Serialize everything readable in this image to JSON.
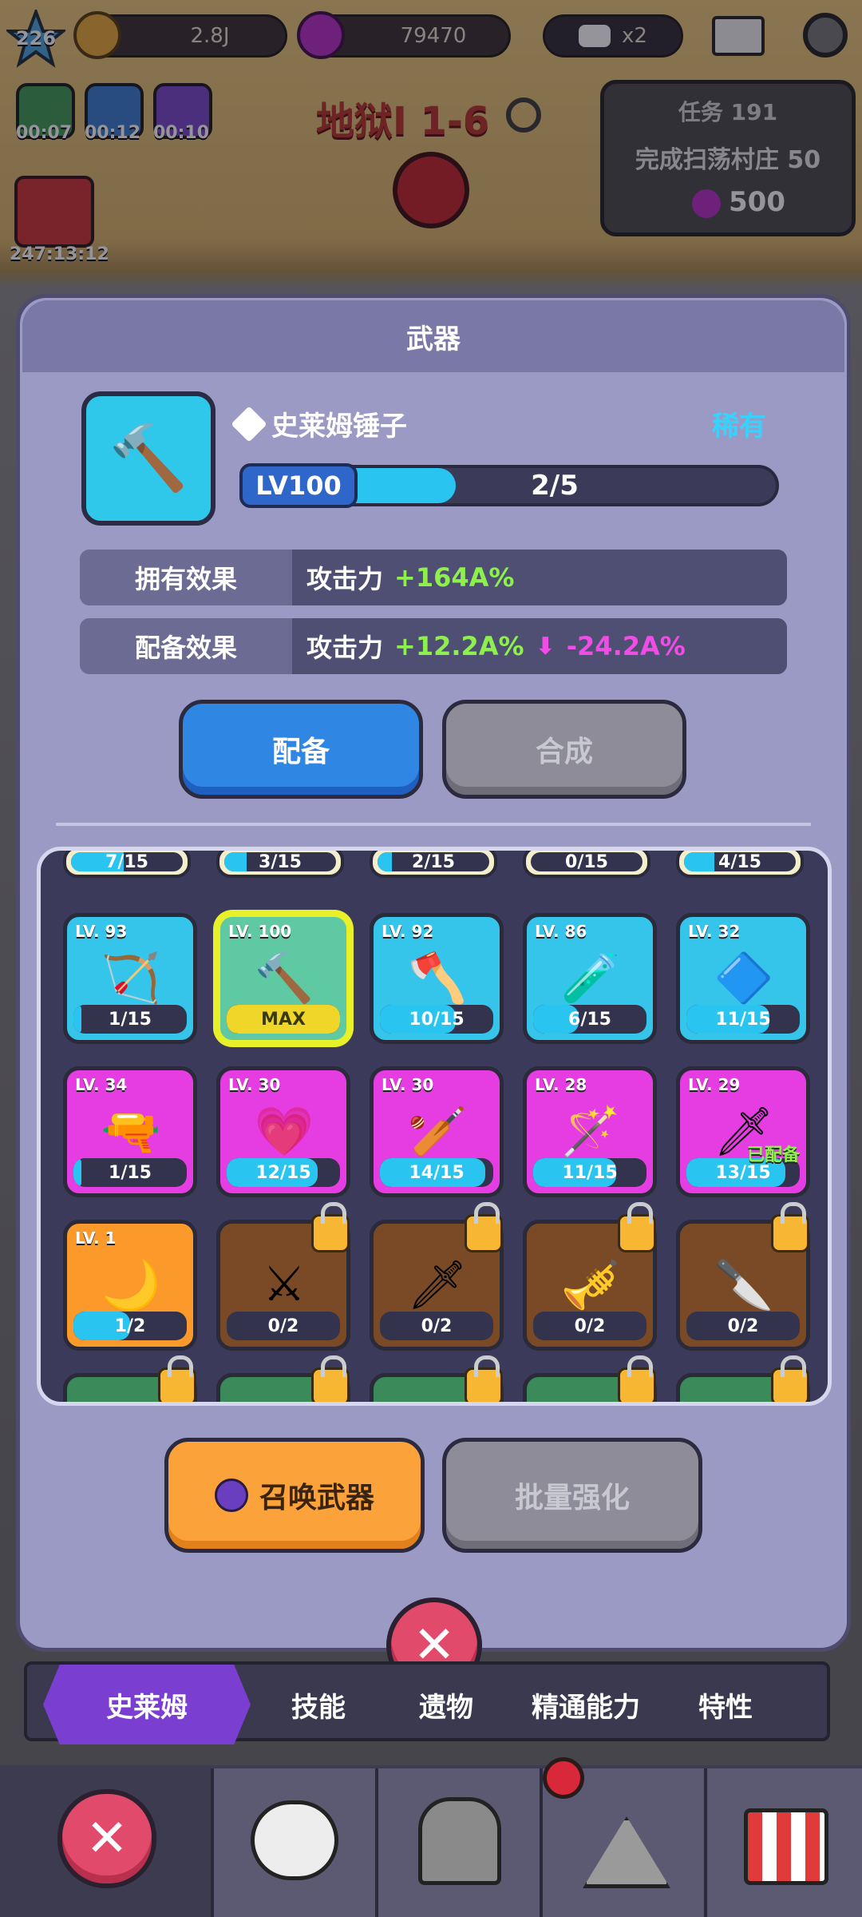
{
  "topbar": {
    "player_level": "226",
    "gold": "2.8J",
    "gems": "79470",
    "video_multiplier": "x2"
  },
  "buffs": [
    {
      "timer": "00:07"
    },
    {
      "timer": "00:12"
    },
    {
      "timer": "00:10"
    }
  ],
  "event_timer": "247:13:12",
  "stage": {
    "name": "地狱I 1-6"
  },
  "quest": {
    "title": "任务 191",
    "desc": "完成扫荡村庄 50",
    "reward": "500"
  },
  "panel": {
    "title": "武器",
    "weapon_name": "史莱姆锤子",
    "rarity": "稀有",
    "level_tag": "LV100",
    "progress_text": "2/5",
    "progress_fraction": 0.4,
    "own_effect_label": "拥有效果",
    "own_effect_stat": "攻击力",
    "own_effect_value": "+164A%",
    "equip_effect_label": "配备效果",
    "equip_effect_stat": "攻击力",
    "equip_effect_value": "+12.2A%",
    "equip_effect_diff": "-24.2A%",
    "equip_button": "配备",
    "merge_button": "合成",
    "summon_button": "召唤武器",
    "bulk_upgrade_button": "批量强化"
  },
  "top_partial_row": [
    {
      "count": "7/15",
      "fill": 0.47
    },
    {
      "count": "3/15",
      "fill": 0.2
    },
    {
      "count": "2/15",
      "fill": 0.13
    },
    {
      "count": "0/15",
      "fill": 0
    },
    {
      "count": "4/15",
      "fill": 0.27
    }
  ],
  "weapons_row1": [
    {
      "level": "LV. 93",
      "count": "1/15",
      "fill": 0.07,
      "color": "blue",
      "icon": "crossbow-icon",
      "glyph": "🏹"
    },
    {
      "level": "LV. 100",
      "count": "MAX",
      "fill": 1,
      "color": "selected",
      "icon": "hammer-icon",
      "glyph": "🔨"
    },
    {
      "level": "LV. 92",
      "count": "10/15",
      "fill": 0.67,
      "color": "blue",
      "icon": "mace-icon",
      "glyph": "🪓"
    },
    {
      "level": "LV. 86",
      "count": "6/15",
      "fill": 0.4,
      "color": "blue",
      "icon": "bottle-icon",
      "glyph": "🧪"
    },
    {
      "level": "LV. 32",
      "count": "11/15",
      "fill": 0.73,
      "color": "blue",
      "icon": "ice-hammer-icon",
      "glyph": "🔷"
    }
  ],
  "weapons_row2": [
    {
      "level": "LV. 34",
      "count": "1/15",
      "fill": 0.07,
      "color": "pink",
      "icon": "rifle-icon",
      "glyph": "🔫"
    },
    {
      "level": "LV. 30",
      "count": "12/15",
      "fill": 0.8,
      "color": "pink",
      "icon": "heart-flower-icon",
      "glyph": "💗"
    },
    {
      "level": "LV. 30",
      "count": "14/15",
      "fill": 0.93,
      "color": "pink",
      "icon": "spiked-club-icon",
      "glyph": "🏏"
    },
    {
      "level": "LV. 28",
      "count": "11/15",
      "fill": 0.73,
      "color": "pink",
      "icon": "magic-wand-icon",
      "glyph": "🪄"
    },
    {
      "level": "LV. 29",
      "count": "13/15",
      "fill": 0.87,
      "color": "pink",
      "icon": "dagger-icon",
      "glyph": "🗡",
      "equipped": "已配备"
    }
  ],
  "weapons_row3": [
    {
      "level": "LV. 1",
      "count": "1/2",
      "fill": 0.5,
      "color": "orange",
      "icon": "sickle-icon",
      "glyph": "🌙"
    },
    {
      "level": "",
      "count": "0/2",
      "fill": 0,
      "color": "brown",
      "icon": "locked-dark-sword-icon",
      "glyph": "⚔",
      "locked": true
    },
    {
      "level": "",
      "count": "0/2",
      "fill": 0,
      "color": "brown",
      "icon": "locked-blade-icon",
      "glyph": "🗡",
      "locked": true
    },
    {
      "level": "",
      "count": "0/2",
      "fill": 0,
      "color": "brown",
      "icon": "locked-trumpet-icon",
      "glyph": "🎺",
      "locked": true
    },
    {
      "level": "",
      "count": "0/2",
      "fill": 0,
      "color": "brown",
      "icon": "locked-red-sword-icon",
      "glyph": "🔪",
      "locked": true
    }
  ],
  "tabs": [
    "史莱姆",
    "技能",
    "遗物",
    "精通能力",
    "特性"
  ]
}
